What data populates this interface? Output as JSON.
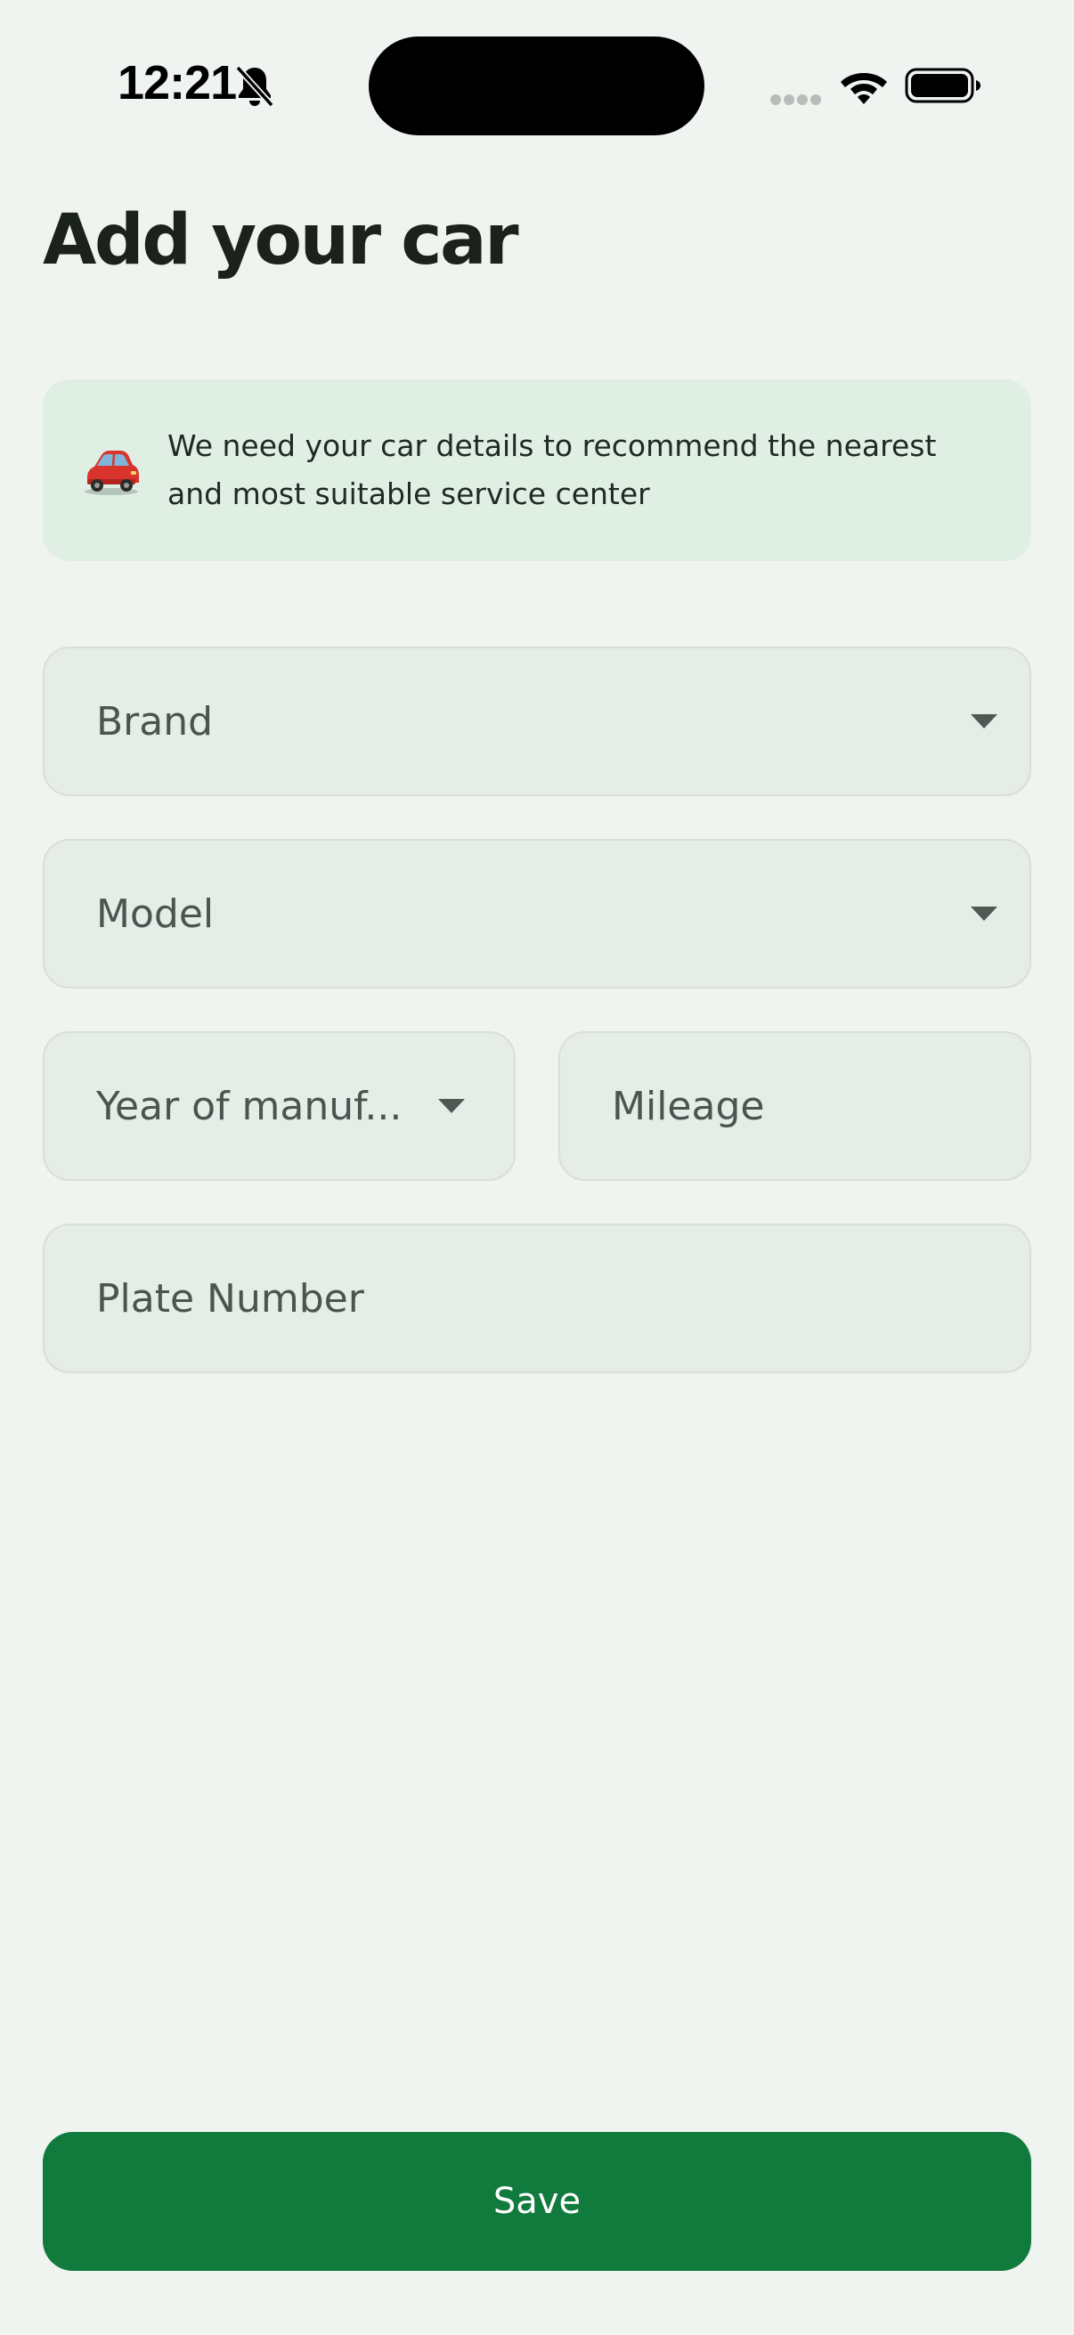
{
  "status_bar": {
    "time": "12:21",
    "icons": [
      "bell-off-icon",
      "signal-icon",
      "wifi-icon",
      "battery-icon"
    ]
  },
  "page": {
    "title": "Add your car"
  },
  "info_banner": {
    "icon": "car-icon",
    "text": "We need your car details to recommend the nearest and most suitable service center",
    "background": "#dfefe3"
  },
  "form": {
    "brand": {
      "placeholder": "Brand",
      "type": "dropdown"
    },
    "model": {
      "placeholder": "Model",
      "type": "dropdown"
    },
    "year": {
      "placeholder": "Year of manuf...",
      "type": "dropdown"
    },
    "mileage": {
      "placeholder": "Mileage",
      "type": "text"
    },
    "plate": {
      "placeholder": "Plate Number",
      "type": "text"
    }
  },
  "actions": {
    "save_label": "Save"
  },
  "colors": {
    "background": "#eff4f0",
    "field_background": "#e6ece8",
    "primary": "#117a3d"
  }
}
